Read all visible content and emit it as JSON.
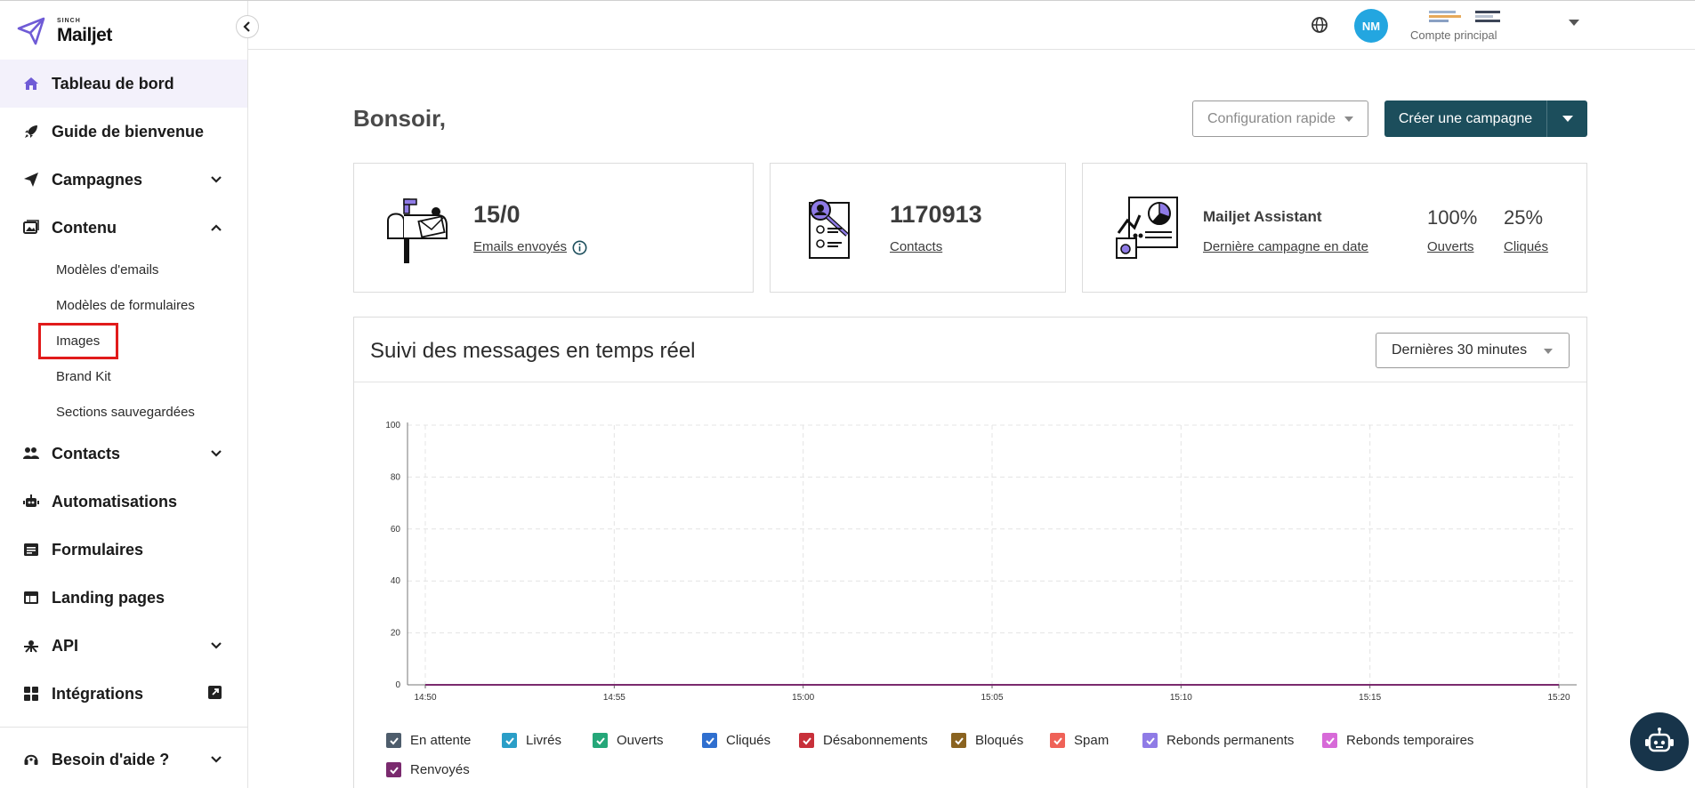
{
  "brand": {
    "small": "SINCH",
    "name": "Mailjet",
    "accent": "#6f5bd6"
  },
  "sidebar": {
    "collapse_icon": "chevron-left-icon",
    "items": [
      {
        "label": "Tableau de bord",
        "icon": "home-icon",
        "active": true
      },
      {
        "label": "Guide de bienvenue",
        "icon": "rocket-icon"
      },
      {
        "label": "Campagnes",
        "icon": "paper-plane-icon",
        "expand": "down"
      },
      {
        "label": "Contenu",
        "icon": "images-icon",
        "expand": "up"
      },
      {
        "label": "Contacts",
        "icon": "users-icon",
        "expand": "down"
      },
      {
        "label": "Automatisations",
        "icon": "robot-icon"
      },
      {
        "label": "Formulaires",
        "icon": "form-icon"
      },
      {
        "label": "Landing pages",
        "icon": "layout-icon"
      },
      {
        "label": "API",
        "icon": "api-icon",
        "expand": "down"
      },
      {
        "label": "Intégrations",
        "icon": "grid-icon",
        "external": true
      }
    ],
    "sub_items": [
      "Modèles d'emails",
      "Modèles de formulaires",
      "Images",
      "Brand Kit",
      "Sections sauvegardées"
    ],
    "highlighted_sub": "Images",
    "help": {
      "label": "Besoin d'aide ?",
      "icon": "headset-icon"
    }
  },
  "topbar": {
    "avatar_initials": "NM",
    "avatar_color": "#23a6e0",
    "account_label": "Compte principal"
  },
  "header": {
    "greeting": "Bonsoir,",
    "config_button": "Configuration rapide",
    "create_button": "Créer une campagne",
    "create_color": "#1c4e5c"
  },
  "stats": {
    "emails": {
      "value": "15/0",
      "label": "Emails envoyés"
    },
    "contacts": {
      "value": "1170913",
      "label": "Contacts"
    },
    "assistant": {
      "title": "Mailjet Assistant",
      "link": "Dernière campagne en date",
      "opened_pct": "100%",
      "opened_label": "Ouverts",
      "clicked_pct": "25%",
      "clicked_label": "Cliqués"
    }
  },
  "tracking": {
    "title": "Suivi des messages en temps réel",
    "range": "Dernières 30 minutes"
  },
  "chart_data": {
    "type": "line",
    "x": [
      "14:50",
      "14:55",
      "15:00",
      "15:05",
      "15:10",
      "15:15",
      "15:20"
    ],
    "ylim": [
      0,
      100
    ],
    "yticks": [
      "100",
      "80",
      "60",
      "40",
      "20",
      "0"
    ],
    "grid": true,
    "legend_position": "bottom",
    "series": [
      {
        "name": "En attente",
        "color": "#4e5d6c",
        "values": [
          0,
          0,
          0,
          0,
          0,
          0,
          0
        ]
      },
      {
        "name": "Livrés",
        "color": "#2a9ec7",
        "values": [
          0,
          0,
          0,
          0,
          0,
          0,
          0
        ]
      },
      {
        "name": "Ouverts",
        "color": "#25a779",
        "values": [
          0,
          0,
          0,
          0,
          0,
          0,
          0
        ]
      },
      {
        "name": "Cliqués",
        "color": "#2f6fcf",
        "values": [
          0,
          0,
          0,
          0,
          0,
          0,
          0
        ]
      },
      {
        "name": "Désabonnements",
        "color": "#c8303a",
        "values": [
          0,
          0,
          0,
          0,
          0,
          0,
          0
        ]
      },
      {
        "name": "Bloqués",
        "color": "#8a6320",
        "values": [
          0,
          0,
          0,
          0,
          0,
          0,
          0
        ]
      },
      {
        "name": "Spam",
        "color": "#ef6258",
        "values": [
          0,
          0,
          0,
          0,
          0,
          0,
          0
        ]
      },
      {
        "name": "Rebonds permanents",
        "color": "#8f7be6",
        "values": [
          0,
          0,
          0,
          0,
          0,
          0,
          0
        ]
      },
      {
        "name": "Rebonds temporaires",
        "color": "#d76ad8",
        "values": [
          0,
          0,
          0,
          0,
          0,
          0,
          0
        ]
      },
      {
        "name": "Renvoyés",
        "color": "#7a2a6e",
        "values": [
          0,
          0,
          0,
          0,
          0,
          0,
          0
        ]
      }
    ]
  },
  "assistant_bot_icon": "chatbot-icon"
}
